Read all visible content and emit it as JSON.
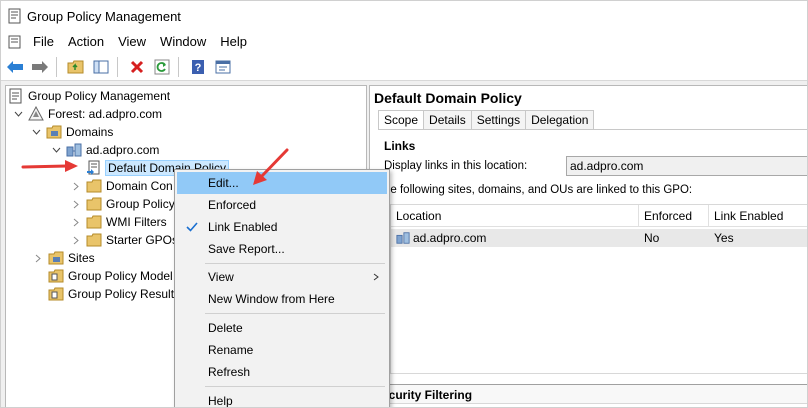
{
  "window": {
    "title": "Group Policy Management"
  },
  "menubar": {
    "items": [
      "File",
      "Action",
      "View",
      "Window",
      "Help"
    ]
  },
  "toolbar": {
    "buttons": [
      "back-arrow-icon",
      "forward-arrow-icon",
      "folder-up-icon",
      "show-hide-tree-icon",
      "delete-icon",
      "refresh-icon",
      "help-icon",
      "properties-icon"
    ]
  },
  "tree": {
    "root": "Group Policy Management",
    "forest": "Forest: ad.adpro.com",
    "domains": "Domains",
    "domain": "ad.adpro.com",
    "default_policy": "Default Domain Policy",
    "domain_controllers": "Domain Con",
    "group_policy_objects": "Group Policy",
    "wmi_filters": "WMI Filters",
    "starter_gpos": "Starter GPOs",
    "sites": "Sites",
    "modeling": "Group Policy Model",
    "results": "Group Policy Results"
  },
  "detail": {
    "title": "Default Domain Policy",
    "tabs": [
      "Scope",
      "Details",
      "Settings",
      "Delegation"
    ],
    "links_heading": "Links",
    "display_label": "Display links in this location:",
    "display_value": "ad.adpro.com",
    "following_text": "he following sites, domains, and OUs are linked to this GPO:",
    "columns": [
      "Location",
      "Enforced",
      "Link Enabled"
    ],
    "rows": [
      {
        "location": "ad.adpro.com",
        "enforced": "No",
        "link_enabled": "Yes"
      }
    ],
    "security_filtering": "ecurity Filtering"
  },
  "context_menu": {
    "edit": "Edit...",
    "enforced": "Enforced",
    "link_enabled": "Link Enabled",
    "save_report": "Save Report...",
    "view": "View",
    "new_window": "New Window from Here",
    "delete": "Delete",
    "rename": "Rename",
    "refresh": "Refresh",
    "help": "Help"
  },
  "colors": {
    "arrow": "#e53935",
    "menu_hover": "#91c9f7",
    "selection": "#cce8ff"
  }
}
